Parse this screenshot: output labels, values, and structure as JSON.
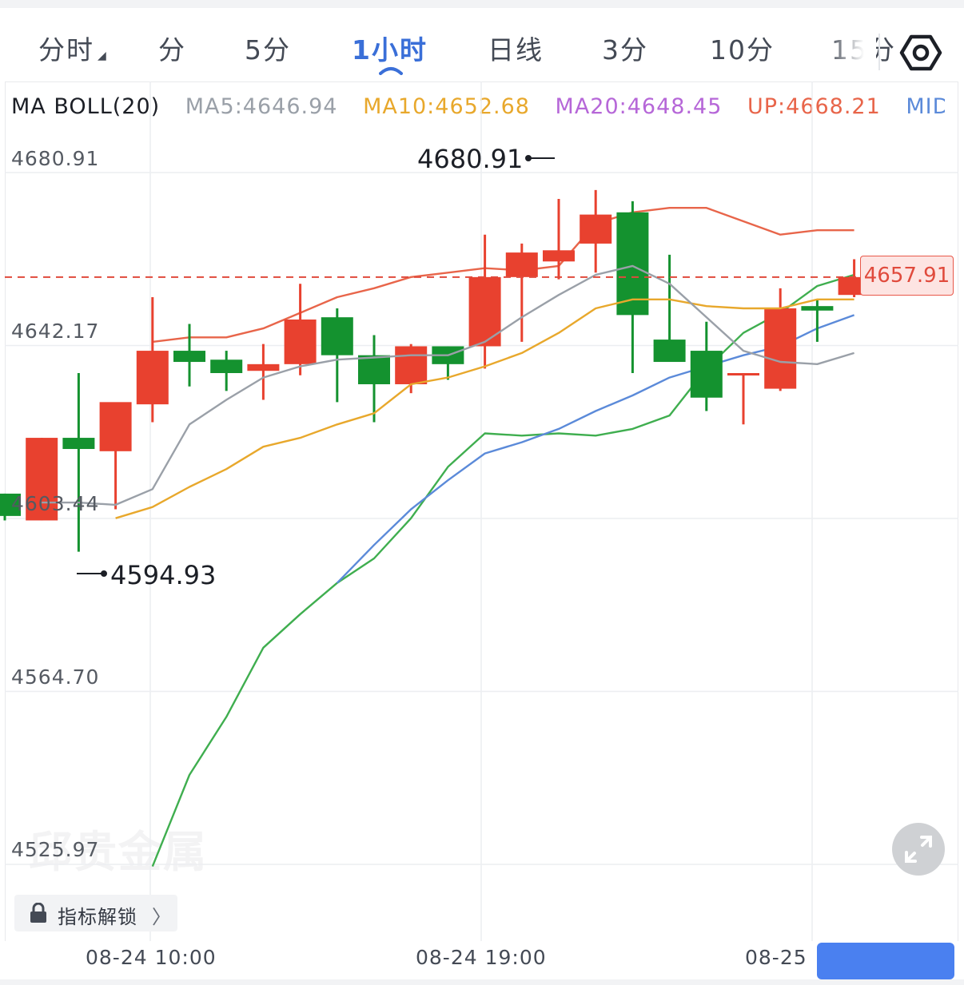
{
  "tabs": [
    {
      "label": "分时"
    },
    {
      "label": "分"
    },
    {
      "label": "5分"
    },
    {
      "label": "1小时"
    },
    {
      "label": "日线"
    },
    {
      "label": "3分"
    },
    {
      "label": "10分"
    },
    {
      "label": "15分"
    }
  ],
  "active_tab": "1小时",
  "legend": {
    "indicator": "MA BOLL(20)",
    "ma5": "MA5:4646.94",
    "ma10": "MA10:4652.68",
    "ma20": "MA20:4648.45",
    "up": "UP:4668.21",
    "mid": "MID"
  },
  "colors": {
    "up_candle": "#e8412f",
    "down_candle": "#14922f",
    "ma5": "#9aa0a8",
    "ma10": "#e8a82c",
    "ma20": "#b667d8",
    "boll_up": "#e8654a",
    "boll_mid": "#5b8ad9",
    "boll_low": "#3fae4f",
    "accent": "#3a6fd8"
  },
  "y_labels": [
    "4680.91",
    "4642.17",
    "4603.44",
    "4564.70",
    "4525.97"
  ],
  "x_labels": [
    "08-24 10:00",
    "08-24 19:00",
    "08-25"
  ],
  "annotations": {
    "high": "4680.91",
    "low": "4594.93"
  },
  "last_price": "4657.91",
  "watermark": "邱贵金属",
  "unlock_label": "指标解锁",
  "chart_data": {
    "type": "candlestick",
    "ylim": [
      4525.97,
      4680.91
    ],
    "candles": [
      {
        "o": 4609.0,
        "h": 4609.0,
        "l": 4603.0,
        "c": 4604.0
      },
      {
        "o": 4603.0,
        "h": 4621.5,
        "l": 4603.0,
        "c": 4621.5
      },
      {
        "o": 4621.5,
        "h": 4636.0,
        "l": 4596.0,
        "c": 4619.0
      },
      {
        "o": 4618.5,
        "h": 4628.5,
        "l": 4605.5,
        "c": 4629.5
      },
      {
        "o": 4629.0,
        "h": 4653.0,
        "l": 4625.0,
        "c": 4641.0
      },
      {
        "o": 4641.0,
        "h": 4647.0,
        "l": 4633.0,
        "c": 4638.5
      },
      {
        "o": 4639.0,
        "h": 4641.0,
        "l": 4632.0,
        "c": 4636.0
      },
      {
        "o": 4636.5,
        "h": 4642.5,
        "l": 4630.0,
        "c": 4638.0
      },
      {
        "o": 4638.0,
        "h": 4656.0,
        "l": 4635.5,
        "c": 4648.0
      },
      {
        "o": 4648.5,
        "h": 4650.5,
        "l": 4629.5,
        "c": 4640.0
      },
      {
        "o": 4640.0,
        "h": 4644.5,
        "l": 4625.0,
        "c": 4633.5
      },
      {
        "o": 4633.5,
        "h": 4642.5,
        "l": 4631.5,
        "c": 4642.0
      },
      {
        "o": 4642.0,
        "h": 4642.0,
        "l": 4634.5,
        "c": 4638.0
      },
      {
        "o": 4642.0,
        "h": 4667.0,
        "l": 4637.0,
        "c": 4657.5
      },
      {
        "o": 4657.5,
        "h": 4665.0,
        "l": 4643.0,
        "c": 4663.0
      },
      {
        "o": 4661.0,
        "h": 4675.0,
        "l": 4657.0,
        "c": 4663.5
      },
      {
        "o": 4665.0,
        "h": 4677.0,
        "l": 4658.5,
        "c": 4671.5
      },
      {
        "o": 4672.0,
        "h": 4674.5,
        "l": 4636.0,
        "c": 4649.0
      },
      {
        "o": 4643.5,
        "h": 4662.5,
        "l": 4640.0,
        "c": 4638.5
      },
      {
        "o": 4641.0,
        "h": 4647.5,
        "l": 4627.5,
        "c": 4630.5
      },
      {
        "o": 4636.0,
        "h": 4636.0,
        "l": 4624.5,
        "c": 4636.0
      },
      {
        "o": 4632.5,
        "h": 4655.0,
        "l": 4632.0,
        "c": 4650.5
      },
      {
        "o": 4651.0,
        "h": 4652.5,
        "l": 4643.0,
        "c": 4650.0
      },
      {
        "o": 4653.5,
        "h": 4661.5,
        "l": 4653.0,
        "c": 4657.5
      }
    ],
    "ma5": [
      4607.0,
      4607.0,
      4606.5,
      4610.0,
      4624.5,
      4630.0,
      4635.0,
      4637.5,
      4639.0,
      4639.5,
      4640.0,
      4640.0,
      4643.0,
      4648.5,
      4653.5,
      4658.0,
      4660.0,
      4656.0,
      4648.5,
      4641.0,
      4638.5,
      4638.0,
      4640.5
    ],
    "ma10": [
      4603.5,
      4606.0,
      4610.5,
      4614.5,
      4619.5,
      4621.5,
      4624.5,
      4627.0,
      4633.5,
      4635.0,
      4637.5,
      4640.5,
      4645.0,
      4650.5,
      4652.5,
      4652.5,
      4651.0,
      4650.5,
      4650.5,
      4652.5,
      4652.5
    ],
    "boll_up": [
      4643.0,
      4644.0,
      4644.0,
      4646.0,
      4649.5,
      4653.0,
      4655.0,
      4657.5,
      4658.5,
      4659.5,
      4659.0,
      4660.0,
      4669.5,
      4672.0,
      4673.0,
      4673.0,
      4670.0,
      4667.0,
      4668.0,
      4668.0
    ],
    "boll_mid": [
      4589.0,
      4597.5,
      4605.5,
      4612.0,
      4618.0,
      4620.5,
      4623.5,
      4627.5,
      4631.0,
      4635.0,
      4637.5,
      4640.0,
      4642.0,
      4646.0,
      4649.0
    ],
    "boll_low": [
      4525.5,
      4546.0,
      4559.0,
      4574.5,
      4582.0,
      4589.0,
      4594.5,
      4603.5,
      4615.0,
      4622.5,
      4622.0,
      4622.5,
      4622.0,
      4623.5,
      4626.5,
      4637.0,
      4645.0,
      4649.5,
      4655.5,
      4658.0
    ]
  }
}
